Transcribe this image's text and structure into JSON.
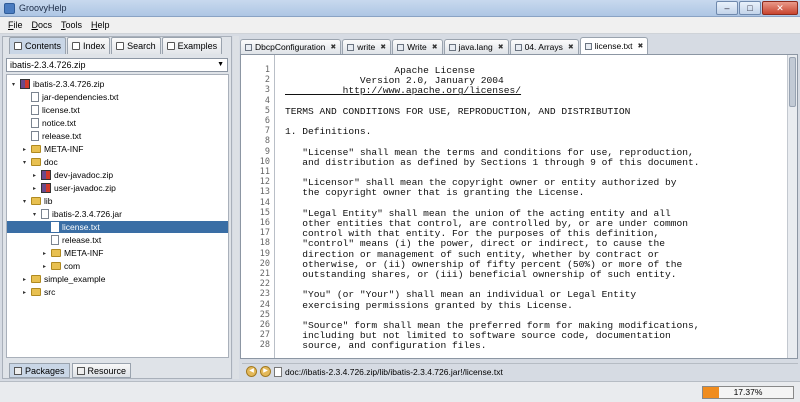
{
  "window": {
    "title": "GroovyHelp",
    "buttons": [
      "–",
      "□",
      "✕"
    ]
  },
  "menu": [
    "File",
    "Docs",
    "Tools",
    "Help"
  ],
  "left_tabs": [
    {
      "label": "Contents",
      "icon": "contents-icon"
    },
    {
      "label": "Index",
      "icon": "index-icon"
    },
    {
      "label": "Search",
      "icon": "search-icon"
    },
    {
      "label": "Examples",
      "icon": "examples-icon"
    }
  ],
  "archive_select": {
    "value": "ibatis-2.3.4.726.zip"
  },
  "tree": [
    {
      "label": "ibatis-2.3.4.726.zip",
      "type": "zip",
      "toggle": "▾"
    },
    {
      "label": "jar-dependencies.txt",
      "type": "file",
      "toggle": ""
    },
    {
      "label": "license.txt",
      "type": "file",
      "toggle": ""
    },
    {
      "label": "notice.txt",
      "type": "file",
      "toggle": ""
    },
    {
      "label": "release.txt",
      "type": "file",
      "toggle": ""
    },
    {
      "label": "META-INF",
      "type": "folder",
      "toggle": "▸"
    },
    {
      "label": "doc",
      "type": "folder",
      "toggle": "▾"
    },
    {
      "label": "dev-javadoc.zip",
      "type": "zip",
      "toggle": "▸"
    },
    {
      "label": "user-javadoc.zip",
      "type": "zip",
      "toggle": "▸"
    },
    {
      "label": "lib",
      "type": "folder",
      "toggle": "▾"
    },
    {
      "label": "ibatis-2.3.4.726.jar",
      "type": "jar",
      "toggle": "▾"
    },
    {
      "label": "license.txt",
      "type": "file",
      "toggle": ""
    },
    {
      "label": "release.txt",
      "type": "file",
      "toggle": ""
    },
    {
      "label": "META-INF",
      "type": "folder",
      "toggle": "▸"
    },
    {
      "label": "com",
      "type": "folder",
      "toggle": "▸"
    },
    {
      "label": "simple_example",
      "type": "folder",
      "toggle": "▸"
    },
    {
      "label": "src",
      "type": "folder",
      "toggle": "▸"
    }
  ],
  "bottom_tabs": [
    "Packages",
    "Resource"
  ],
  "doc_tabs": [
    {
      "label": "DbcpConfiguration"
    },
    {
      "label": "write"
    },
    {
      "label": "Write"
    },
    {
      "label": "java.lang"
    },
    {
      "label": "04. Arrays"
    },
    {
      "label": "license.txt"
    }
  ],
  "code_lines": [
    "                   Apache License",
    "             Version 2.0, January 2004",
    "          http://www.apache.org/licenses/",
    "",
    "TERMS AND CONDITIONS FOR USE, REPRODUCTION, AND DISTRIBUTION",
    "",
    "1. Definitions.",
    "",
    "   \"License\" shall mean the terms and conditions for use, reproduction,",
    "   and distribution as defined by Sections 1 through 9 of this document.",
    "",
    "   \"Licensor\" shall mean the copyright owner or entity authorized by",
    "   the copyright owner that is granting the License.",
    "",
    "   \"Legal Entity\" shall mean the union of the acting entity and all",
    "   other entities that control, are controlled by, or are under common",
    "   control with that entity. For the purposes of this definition,",
    "   \"control\" means (i) the power, direct or indirect, to cause the",
    "   direction or management of such entity, whether by contract or",
    "   otherwise, or (ii) ownership of fifty percent (50%) or more of the",
    "   outstanding shares, or (iii) beneficial ownership of such entity.",
    "",
    "   \"You\" (or \"Your\") shall mean an individual or Legal Entity",
    "   exercising permissions granted by this License.",
    "",
    "   \"Source\" form shall mean the preferred form for making modifications,",
    "   including but not limited to software source code, documentation",
    "   source, and configuration files."
  ],
  "address": {
    "path": "doc://ibatis-2.3.4.726.zip/lib/ibatis-2.3.4.726.jar!/license.txt"
  },
  "status": {
    "progress_pct": 17.37,
    "progress_label": "17.37%"
  }
}
